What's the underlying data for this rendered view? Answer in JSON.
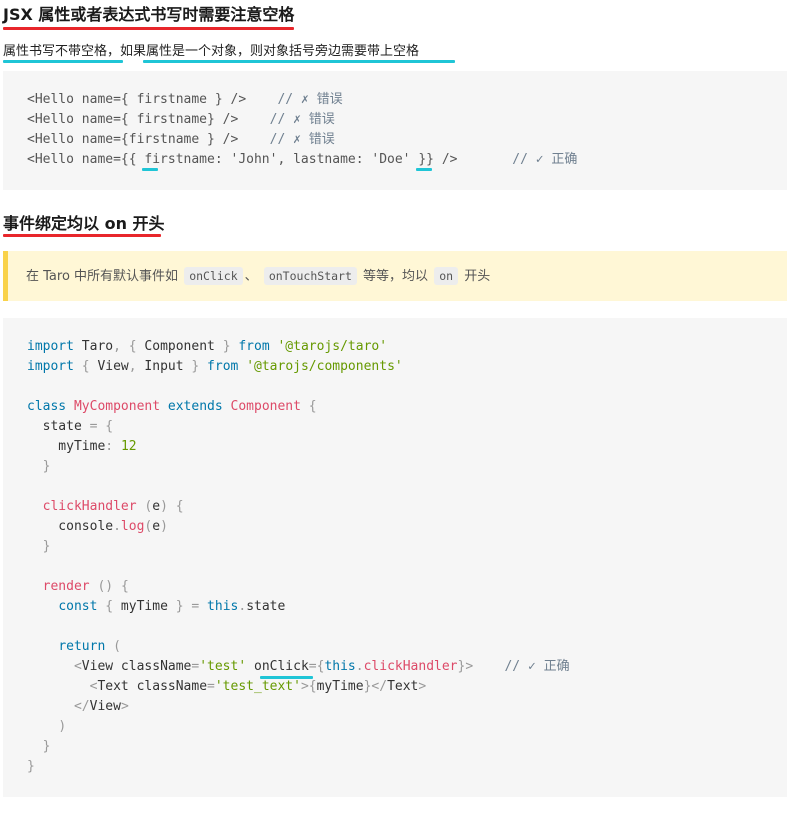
{
  "section1": {
    "heading": "JSX 属性或者表达式书写时需要注意空格",
    "intro_part1": "属性书写不带空格，",
    "intro_part2": "如果属性是一个对象，则对象括号旁边需要带上空格"
  },
  "code1": {
    "lines": [
      {
        "a": "<Hello name={ firstname } />",
        "comment": "// ✗ 错误"
      },
      {
        "a": "<Hello name={ firstname} />",
        "comment": "// ✗ 错误"
      },
      {
        "a": "<Hello name={firstname } />",
        "comment": "// ✗ 错误"
      },
      {
        "a": "<Hello name={{ firstname: 'John', lastname: 'Doe' }} />",
        "comment": "// ✓ 正确"
      }
    ]
  },
  "section2": {
    "heading": "事件绑定均以 on 开头"
  },
  "tip": {
    "text1": "在 Taro 中所有默认事件如",
    "code1": "onClick",
    "sep": "、",
    "code2": "onTouchStart",
    "text2": "等等，均以",
    "code3": "on",
    "text3": "开头"
  },
  "code2": {
    "lines": [
      "import Taro, { Component } from '@tarojs/taro'",
      "import { View, Input } from '@tarojs/components'",
      "",
      "class MyComponent extends Component {",
      "  state = {",
      "    myTime: 12",
      "  }",
      "",
      "  clickHandler (e) {",
      "    console.log(e)",
      "  }",
      "",
      "  render () {",
      "    const { myTime } = this.state",
      "",
      "    return (",
      "      <View className='test' onClick={this.clickHandler}>    // ✓ 正确",
      "        <Text className='test_text'>{myTime}</Text>",
      "      </View>",
      "    )",
      "  }",
      "}"
    ]
  },
  "colors": {
    "heading_underline": "#e8262b",
    "highlight_underline": "#1fc5d6",
    "code_bg": "#f6f6f6",
    "tip_bg": "#fff7d6",
    "tip_bar": "#f9d24a"
  }
}
